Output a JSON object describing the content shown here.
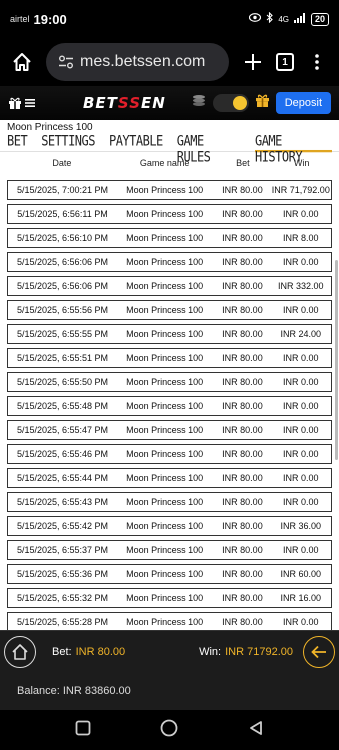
{
  "status": {
    "carrier": "airtel",
    "time": "19:00",
    "signal": "4G",
    "battery": "20"
  },
  "browser": {
    "url": "mes.betssen.com",
    "tab_count": "1"
  },
  "site": {
    "logo_left": "BET",
    "logo_mid": "SS",
    "logo_right": "EN",
    "deposit_label": "Deposit"
  },
  "game": {
    "title": "Moon Princess 100",
    "tabs": [
      "BET",
      "SETTINGS",
      "PAYTABLE",
      "GAME RULES",
      "GAME HISTORY"
    ],
    "active_tab": "GAME HISTORY",
    "columns": [
      "Date",
      "Game name",
      "Bet",
      "Win"
    ],
    "rows": [
      [
        "5/15/2025, 7:00:21 PM",
        "Moon Princess 100",
        "INR 80.00",
        "INR 71,792.00"
      ],
      [
        "5/15/2025, 6:56:11 PM",
        "Moon Princess 100",
        "INR 80.00",
        "INR 0.00"
      ],
      [
        "5/15/2025, 6:56:10 PM",
        "Moon Princess 100",
        "INR 80.00",
        "INR 8.00"
      ],
      [
        "5/15/2025, 6:56:06 PM",
        "Moon Princess 100",
        "INR 80.00",
        "INR 0.00"
      ],
      [
        "5/15/2025, 6:56:06 PM",
        "Moon Princess 100",
        "INR 80.00",
        "INR 332.00"
      ],
      [
        "5/15/2025, 6:55:56 PM",
        "Moon Princess 100",
        "INR 80.00",
        "INR 0.00"
      ],
      [
        "5/15/2025, 6:55:55 PM",
        "Moon Princess 100",
        "INR 80.00",
        "INR 24.00"
      ],
      [
        "5/15/2025, 6:55:51 PM",
        "Moon Princess 100",
        "INR 80.00",
        "INR 0.00"
      ],
      [
        "5/15/2025, 6:55:50 PM",
        "Moon Princess 100",
        "INR 80.00",
        "INR 0.00"
      ],
      [
        "5/15/2025, 6:55:48 PM",
        "Moon Princess 100",
        "INR 80.00",
        "INR 0.00"
      ],
      [
        "5/15/2025, 6:55:47 PM",
        "Moon Princess 100",
        "INR 80.00",
        "INR 0.00"
      ],
      [
        "5/15/2025, 6:55:46 PM",
        "Moon Princess 100",
        "INR 80.00",
        "INR 0.00"
      ],
      [
        "5/15/2025, 6:55:44 PM",
        "Moon Princess 100",
        "INR 80.00",
        "INR 0.00"
      ],
      [
        "5/15/2025, 6:55:43 PM",
        "Moon Princess 100",
        "INR 80.00",
        "INR 0.00"
      ],
      [
        "5/15/2025, 6:55:42 PM",
        "Moon Princess 100",
        "INR 80.00",
        "INR 36.00"
      ],
      [
        "5/15/2025, 6:55:37 PM",
        "Moon Princess 100",
        "INR 80.00",
        "INR 0.00"
      ],
      [
        "5/15/2025, 6:55:36 PM",
        "Moon Princess 100",
        "INR 80.00",
        "INR 60.00"
      ],
      [
        "5/15/2025, 6:55:32 PM",
        "Moon Princess 100",
        "INR 80.00",
        "INR 16.00"
      ],
      [
        "5/15/2025, 6:55:28 PM",
        "Moon Princess 100",
        "INR 80.00",
        "INR 0.00"
      ]
    ]
  },
  "betbar": {
    "bet_label": "Bet:",
    "bet_value": "INR 80.00",
    "win_label": "Win:",
    "win_value": "INR 71792.00"
  },
  "balance": {
    "text": "Balance: INR 83860.00"
  },
  "colors": {
    "accent": "#f0b429",
    "deposit": "#1e6ff0",
    "logo_red": "#e11f2b"
  }
}
